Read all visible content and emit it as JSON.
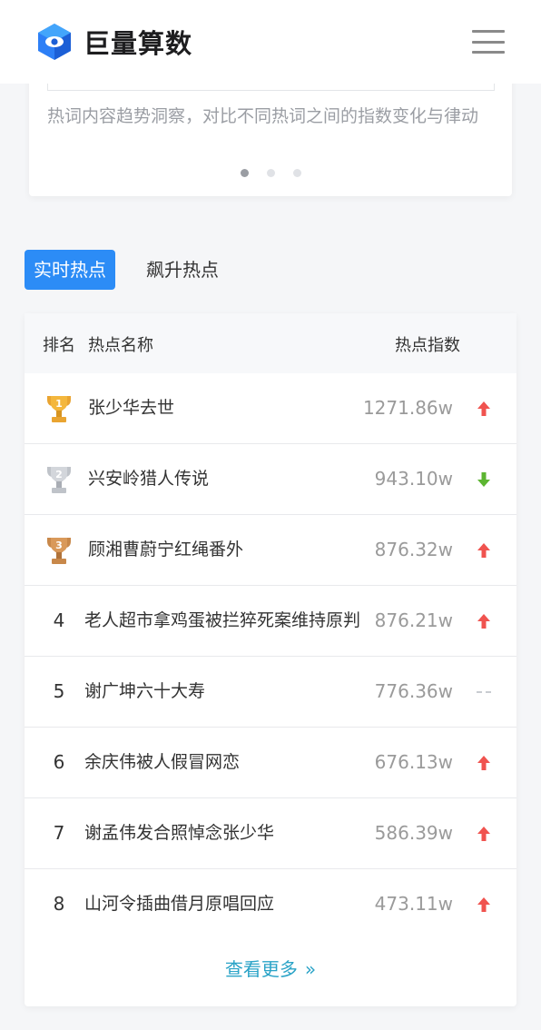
{
  "header": {
    "brand_name": "巨量算数",
    "logo_icon": "juliang-logo-icon",
    "menu_icon": "hamburger-menu-icon"
  },
  "carousel": {
    "description": "热词内容趋势洞察，对比不同热词之间的指数变化与律动",
    "slide_count": 3,
    "active_index": 0
  },
  "tabs": [
    {
      "label": "实时热点",
      "active": true
    },
    {
      "label": "飙升热点",
      "active": false
    }
  ],
  "table": {
    "headers": {
      "rank": "排名",
      "name": "热点名称",
      "index": "热点指数"
    },
    "rows": [
      {
        "rank": "1",
        "name": "张少华去世",
        "value": "1271.86w",
        "trend": "up",
        "badge": "gold-trophy-icon"
      },
      {
        "rank": "2",
        "name": "兴安岭猎人传说",
        "value": "943.10w",
        "trend": "down",
        "badge": "silver-trophy-icon"
      },
      {
        "rank": "3",
        "name": "顾湘曹蔚宁红绳番外",
        "value": "876.32w",
        "trend": "up",
        "badge": "bronze-trophy-icon"
      },
      {
        "rank": "4",
        "name": "老人超市拿鸡蛋被拦猝死案维持原判",
        "value": "876.21w",
        "trend": "up"
      },
      {
        "rank": "5",
        "name": "谢广坤六十大寿",
        "value": "776.36w",
        "trend": "flat"
      },
      {
        "rank": "6",
        "name": "余庆伟被人假冒网恋",
        "value": "676.13w",
        "trend": "up"
      },
      {
        "rank": "7",
        "name": "谢孟伟发合照悼念张少华",
        "value": "586.39w",
        "trend": "up"
      },
      {
        "rank": "8",
        "name": "山河令插曲借月原唱回应",
        "value": "473.11w",
        "trend": "up"
      }
    ],
    "more_label": "查看更多"
  },
  "colors": {
    "accent": "#2c8cf6",
    "up": "#f0534f",
    "down": "#5cb531",
    "flat": "#c9ccd1",
    "link": "#2aa3c7"
  }
}
